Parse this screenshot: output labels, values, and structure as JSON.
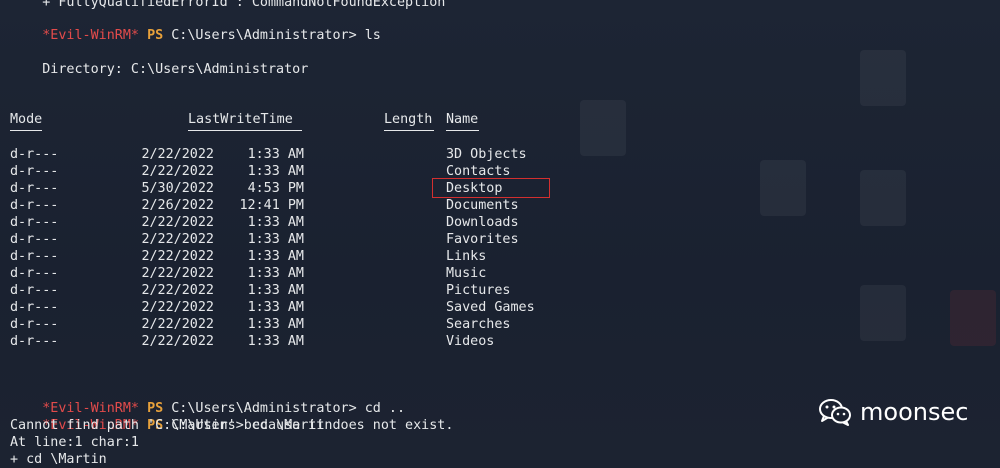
{
  "terminal": {
    "top_partial": "    + FullyQualifiedErrorId : CommandNotFoundException",
    "prompt_tag": "*Evil-WinRM*",
    "prompt_ps": "PS",
    "cmd1": "C:\\Users\\Administrator> ls",
    "dir_line": "    Directory: C:\\Users\\Administrator",
    "headers": {
      "mode": "Mode",
      "lastwrite": "LastWriteTime",
      "length": "Length",
      "name": "Name"
    },
    "rows": [
      {
        "mode": "d-r---",
        "date": "2/22/2022",
        "time": "1:33 AM",
        "name": "3D Objects"
      },
      {
        "mode": "d-r---",
        "date": "2/22/2022",
        "time": "1:33 AM",
        "name": "Contacts"
      },
      {
        "mode": "d-r---",
        "date": "5/30/2022",
        "time": "4:53 PM",
        "name": "Desktop"
      },
      {
        "mode": "d-r---",
        "date": "2/26/2022",
        "time": "12:41 PM",
        "name": "Documents"
      },
      {
        "mode": "d-r---",
        "date": "2/22/2022",
        "time": "1:33 AM",
        "name": "Downloads"
      },
      {
        "mode": "d-r---",
        "date": "2/22/2022",
        "time": "1:33 AM",
        "name": "Favorites"
      },
      {
        "mode": "d-r---",
        "date": "2/22/2022",
        "time": "1:33 AM",
        "name": "Links"
      },
      {
        "mode": "d-r---",
        "date": "2/22/2022",
        "time": "1:33 AM",
        "name": "Music"
      },
      {
        "mode": "d-r---",
        "date": "2/22/2022",
        "time": "1:33 AM",
        "name": "Pictures"
      },
      {
        "mode": "d-r---",
        "date": "2/22/2022",
        "time": "1:33 AM",
        "name": "Saved Games"
      },
      {
        "mode": "d-r---",
        "date": "2/22/2022",
        "time": "1:33 AM",
        "name": "Searches"
      },
      {
        "mode": "d-r---",
        "date": "2/22/2022",
        "time": "1:33 AM",
        "name": "Videos"
      }
    ],
    "cmd2": "C:\\Users\\Administrator> cd ..",
    "cmd3": "C:\\Users> cd \\Martin",
    "err1": "Cannot find path 'C:\\Martin' because it does not exist.",
    "err2": "At line:1 char:1",
    "err3": "+ cd \\Martin"
  },
  "watermark": {
    "text": "moonsec",
    "icon": "wechat-icon"
  },
  "colors": {
    "prompt_tag": "#e34b4b",
    "prompt_ps": "#e8a13b",
    "text": "#e6e8ea",
    "highlight_box": "#d32f2f",
    "background": "#1b2230"
  }
}
